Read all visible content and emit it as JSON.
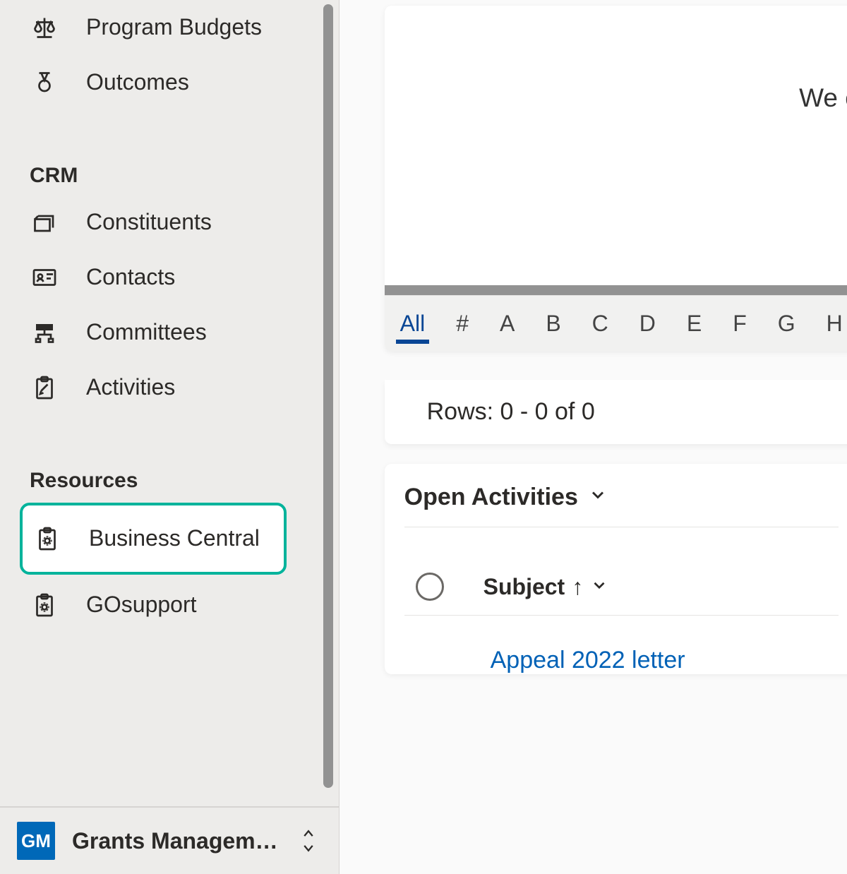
{
  "sidebar": {
    "items_top": [
      {
        "label": "Program Budgets",
        "icon": "balance-icon"
      },
      {
        "label": "Outcomes",
        "icon": "medal-icon"
      }
    ],
    "section_crm": "CRM",
    "items_crm": [
      {
        "label": "Constituents",
        "icon": "folder-stack-icon"
      },
      {
        "label": "Contacts",
        "icon": "contact-card-icon"
      },
      {
        "label": "Committees",
        "icon": "org-chart-icon"
      },
      {
        "label": "Activities",
        "icon": "clipboard-edit-icon"
      }
    ],
    "section_resources": "Resources",
    "items_resources": [
      {
        "label": "Business Central",
        "icon": "clipboard-gear-icon",
        "highlighted": true
      },
      {
        "label": "GOsupport",
        "icon": "clipboard-gear-icon"
      }
    ],
    "app_picker": {
      "avatar": "GM",
      "name": "Grants Managem…"
    }
  },
  "main": {
    "empty_message_partial": "We c",
    "alpha_filter": {
      "items": [
        "All",
        "#",
        "A",
        "B",
        "C",
        "D",
        "E",
        "F",
        "G",
        "H"
      ],
      "active": "All"
    },
    "rows_text": "Rows: 0 - 0 of 0",
    "activities": {
      "title": "Open Activities",
      "column": "Subject",
      "sort_arrow": "↑",
      "rows": [
        {
          "link": "Appeal 2022 letter"
        }
      ]
    }
  }
}
